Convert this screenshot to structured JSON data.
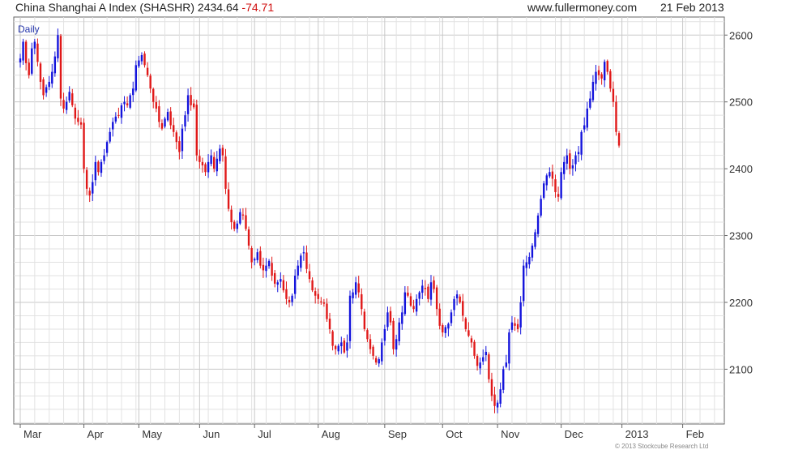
{
  "header": {
    "index_name": "China Shanghai A Index (SHASHR)",
    "last_value": "2434.64",
    "change": "-74.71",
    "website": "www.fullermoney.com",
    "date": "21 Feb 2013"
  },
  "copyright": "© 2013 Stockcube Research Ltd",
  "colors": {
    "up": "#1414dc",
    "down": "#e01818",
    "grid": "#e2e2e2",
    "major_grid": "#c8c8c8"
  },
  "chart_data": {
    "type": "candlestick",
    "period_label": "Daily",
    "ylim": [
      2018,
      2627
    ],
    "y_ticks": [
      2100,
      2200,
      2300,
      2400,
      2500,
      2600
    ],
    "y_axis_side": "right",
    "months": [
      {
        "label": "Mar",
        "start_day": 0
      },
      {
        "label": "Apr",
        "start_day": 22
      },
      {
        "label": "May",
        "start_day": 41
      },
      {
        "label": "Jun",
        "start_day": 62
      },
      {
        "label": "Jul",
        "start_day": 81
      },
      {
        "label": "Aug",
        "start_day": 103
      },
      {
        "label": "Sep",
        "start_day": 126
      },
      {
        "label": "Oct",
        "start_day": 146
      },
      {
        "label": "Nov",
        "start_day": 165
      },
      {
        "label": "Dec",
        "start_day": 187
      },
      {
        "label": "2013",
        "start_day": 208
      },
      {
        "label": "Feb",
        "start_day": 229
      }
    ],
    "total_days": 243,
    "closes": [
      2565,
      2590,
      2558,
      2540,
      2580,
      2590,
      2560,
      2530,
      2510,
      2522,
      2530,
      2545,
      2568,
      2600,
      2505,
      2490,
      2500,
      2515,
      2495,
      2475,
      2470,
      2466,
      2400,
      2370,
      2360,
      2380,
      2410,
      2395,
      2410,
      2420,
      2440,
      2455,
      2470,
      2478,
      2480,
      2495,
      2500,
      2495,
      2510,
      2520,
      2555,
      2562,
      2570,
      2555,
      2540,
      2520,
      2500,
      2490,
      2470,
      2460,
      2475,
      2485,
      2465,
      2455,
      2440,
      2425,
      2460,
      2480,
      2510,
      2495,
      2492,
      2420,
      2410,
      2405,
      2395,
      2410,
      2420,
      2400,
      2415,
      2430,
      2420,
      2370,
      2340,
      2320,
      2310,
      2318,
      2335,
      2330,
      2310,
      2285,
      2260,
      2265,
      2275,
      2255,
      2248,
      2255,
      2262,
      2240,
      2228,
      2230,
      2235,
      2218,
      2205,
      2200,
      2210,
      2240,
      2255,
      2270,
      2275,
      2250,
      2235,
      2218,
      2210,
      2205,
      2200,
      2198,
      2175,
      2160,
      2135,
      2130,
      2135,
      2140,
      2125,
      2140,
      2210,
      2215,
      2230,
      2215,
      2190,
      2160,
      2145,
      2130,
      2120,
      2110,
      2115,
      2140,
      2160,
      2185,
      2170,
      2130,
      2145,
      2170,
      2185,
      2215,
      2210,
      2195,
      2190,
      2205,
      2215,
      2225,
      2220,
      2205,
      2230,
      2220,
      2190,
      2165,
      2155,
      2163,
      2168,
      2185,
      2205,
      2212,
      2200,
      2180,
      2160,
      2150,
      2140,
      2120,
      2105,
      2110,
      2118,
      2126,
      2085,
      2060,
      2045,
      2050,
      2070,
      2100,
      2110,
      2155,
      2170,
      2165,
      2160,
      2200,
      2255,
      2260,
      2268,
      2285,
      2305,
      2330,
      2355,
      2378,
      2390,
      2395,
      2385,
      2365,
      2358,
      2395,
      2410,
      2420,
      2400,
      2405,
      2420,
      2425,
      2455,
      2465,
      2490,
      2505,
      2530,
      2545,
      2540,
      2535,
      2560,
      2545,
      2520,
      2500,
      2455,
      2434.64
    ]
  }
}
